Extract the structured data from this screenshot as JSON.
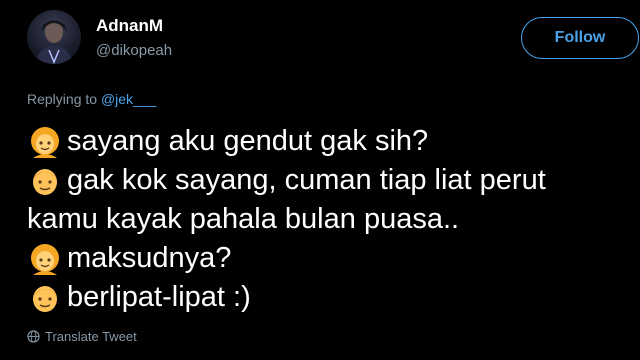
{
  "user": {
    "display_name": "AdnanM",
    "handle": "@dikopeah",
    "avatar_icon": "user-avatar"
  },
  "follow_button": {
    "label": "Follow",
    "color": "#4aa3e8"
  },
  "reply": {
    "prefix": "Replying to ",
    "mention": "@jek___"
  },
  "tweet": {
    "lines": [
      {
        "emoji": "woman-emoji",
        "text": "sayang aku gendut gak sih?"
      },
      {
        "emoji": "man-emoji",
        "text": "gak kok sayang, cuman tiap liat perut"
      },
      {
        "emoji": null,
        "text": "kamu kayak pahala bulan puasa.."
      },
      {
        "emoji": "woman-emoji",
        "text": "maksudnya?"
      },
      {
        "emoji": "man-emoji",
        "text": "berlipat-lipat :)"
      }
    ]
  },
  "translate": {
    "label": "Translate Tweet",
    "icon": "globe-icon"
  },
  "colors": {
    "background": "#000000",
    "text": "#ffffff",
    "muted": "#8899a6",
    "accent": "#4aa3e8"
  }
}
